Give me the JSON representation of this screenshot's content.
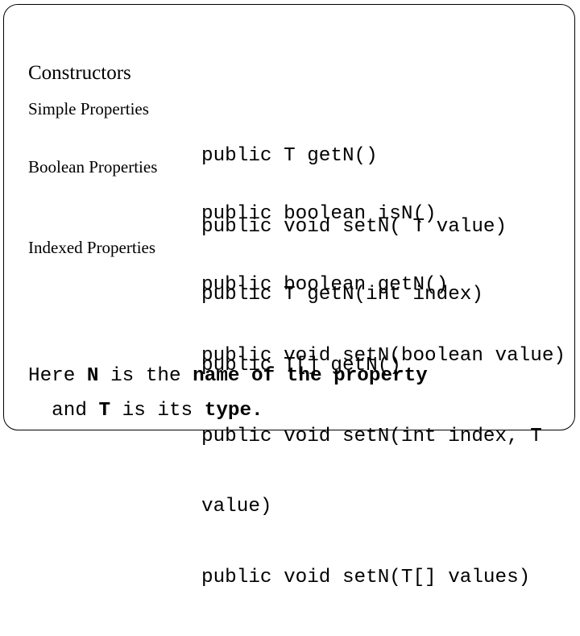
{
  "title": "Constructors",
  "rows": [
    {
      "label": "Simple Properties",
      "lines": [
        "public T getN()",
        "public void setN( T value)"
      ]
    },
    {
      "label": "Boolean Properties",
      "lines": [
        "public boolean isN()",
        "public boolean getN()",
        "public void setN(boolean value)"
      ]
    },
    {
      "label": "Indexed Properties",
      "lines": [
        "public T getN(int index)",
        "public T[] getN()",
        "public void setN(int index, T",
        "value)",
        "public void setN(T[] values)"
      ]
    }
  ],
  "note": {
    "line1": [
      {
        "text": "Here ",
        "bold": false
      },
      {
        "text": "N",
        "bold": true
      },
      {
        "text": " is the ",
        "bold": false
      },
      {
        "text": "name of the property",
        "bold": true
      }
    ],
    "line2": [
      {
        "text": "  and ",
        "bold": false
      },
      {
        "text": "T",
        "bold": true
      },
      {
        "text": " is its ",
        "bold": false
      },
      {
        "text": "type.",
        "bold": true
      }
    ]
  }
}
